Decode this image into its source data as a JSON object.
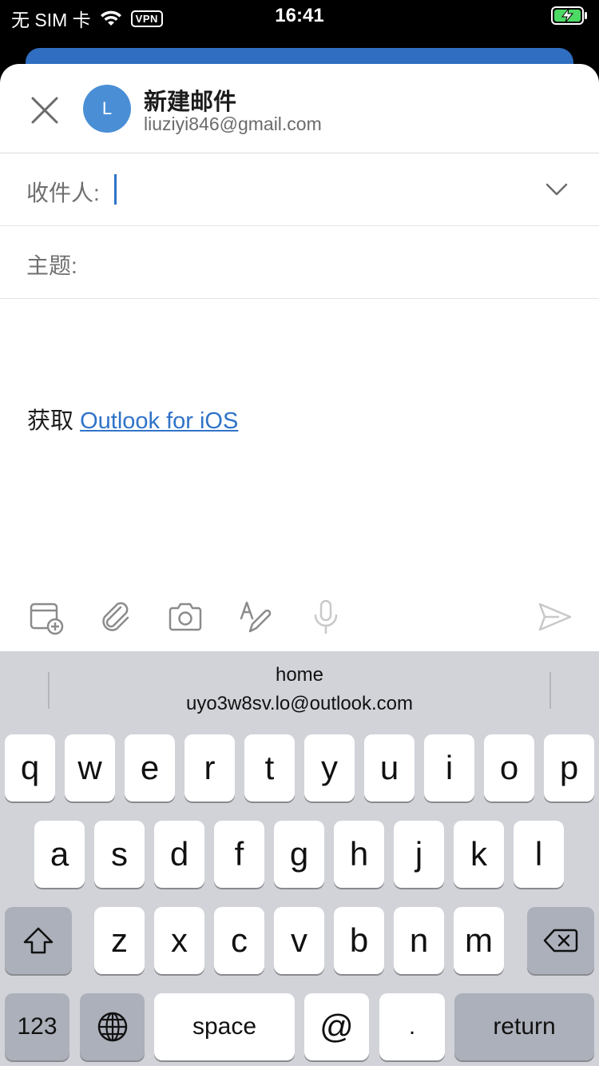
{
  "status_bar": {
    "carrier": "无 SIM 卡",
    "vpn": "VPN",
    "time": "16:41"
  },
  "compose": {
    "title": "新建邮件",
    "account_email": "liuziyi846@gmail.com",
    "avatar_letter": "L",
    "to_label": "收件人:",
    "subject_label": "主题:",
    "body_prefix": "获取",
    "body_link": "Outlook for iOS"
  },
  "toolbar": {
    "icons": [
      "calendar-add-icon",
      "attachment-icon",
      "camera-icon",
      "format-pen-icon",
      "microphone-icon",
      "send-icon"
    ]
  },
  "keyboard": {
    "suggestion_line1": "home",
    "suggestion_line2": "uyo3w8sv.lo@outlook.com",
    "row1": [
      "q",
      "w",
      "e",
      "r",
      "t",
      "y",
      "u",
      "i",
      "o",
      "p"
    ],
    "row2": [
      "a",
      "s",
      "d",
      "f",
      "g",
      "h",
      "j",
      "k",
      "l"
    ],
    "row3": [
      "z",
      "x",
      "c",
      "v",
      "b",
      "n",
      "m"
    ],
    "key_123": "123",
    "key_space": "space",
    "key_at": "@",
    "key_dot": ".",
    "key_return": "return"
  },
  "colors": {
    "accent": "#2f73c9",
    "avatar": "#4a8fd6",
    "keyboard_bg": "#d1d3d9"
  }
}
